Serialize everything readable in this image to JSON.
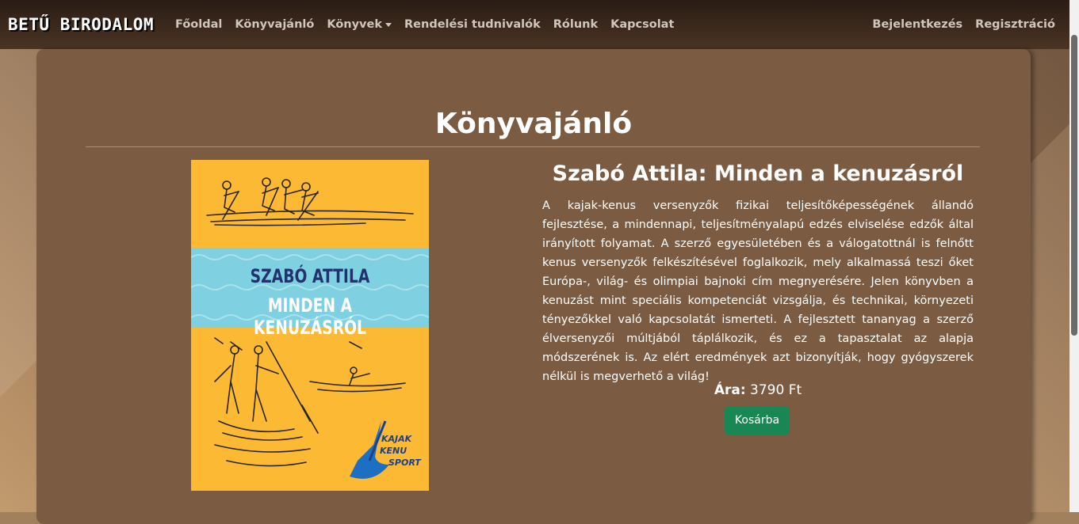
{
  "navbar": {
    "brand": "BETŰ BIRODALOM",
    "links": [
      "Főoldal",
      "Könyvajánló",
      "Könyvek",
      "Rendelési tudnivalók",
      "Rólunk",
      "Kapcsolat"
    ],
    "right_links": [
      "Bejelentkezés",
      "Regisztráció"
    ]
  },
  "main": {
    "page_title": "Könyvajánló",
    "book": {
      "cover": {
        "author": "SZABÓ ATTILA",
        "title": "MINDEN A KENUZÁSRÓL",
        "logo": [
          "KAJAK",
          "KENU",
          "SPORT"
        ]
      },
      "title": "Szabó Attila: Minden a kenuzásról",
      "description": "A kajak-kenus versenyzők fizikai teljesítőképességének állandó fejlesztése, a mindennapi, teljesítményalapú edzés elviselése edzők által irányított folyamat. A szerző egyesületében és a válogatottnál is felnőtt kenus versenyzők felkészítésével foglalkozik, mely alkalmassá teszi őket Európa-, világ- és olimpiai bajnoki cím megnyerésére. Jelen könyvben a kenuzást mint speciális kompetenciát vizsgálja, és technikai, környezeti tényezőkkel való kapcsolatát ismerteti. A fejlesztett tananyag a szerző élversenyzői múltjából táplálkozik, és ez a tapasztalat az alapja módszerének is. Az elért eredmények azt bizonyítják, hogy gyógyszerek nélkül is megverhető a világ!",
      "price_label": "Ára:",
      "price_value": "3790 Ft",
      "cart_button": "Kosárba"
    }
  },
  "colors": {
    "navbar": "#3a281c",
    "card": "#7b5c43",
    "cover": "#fbb934",
    "cover_band": "#7fd0e0",
    "button": "#198754"
  }
}
